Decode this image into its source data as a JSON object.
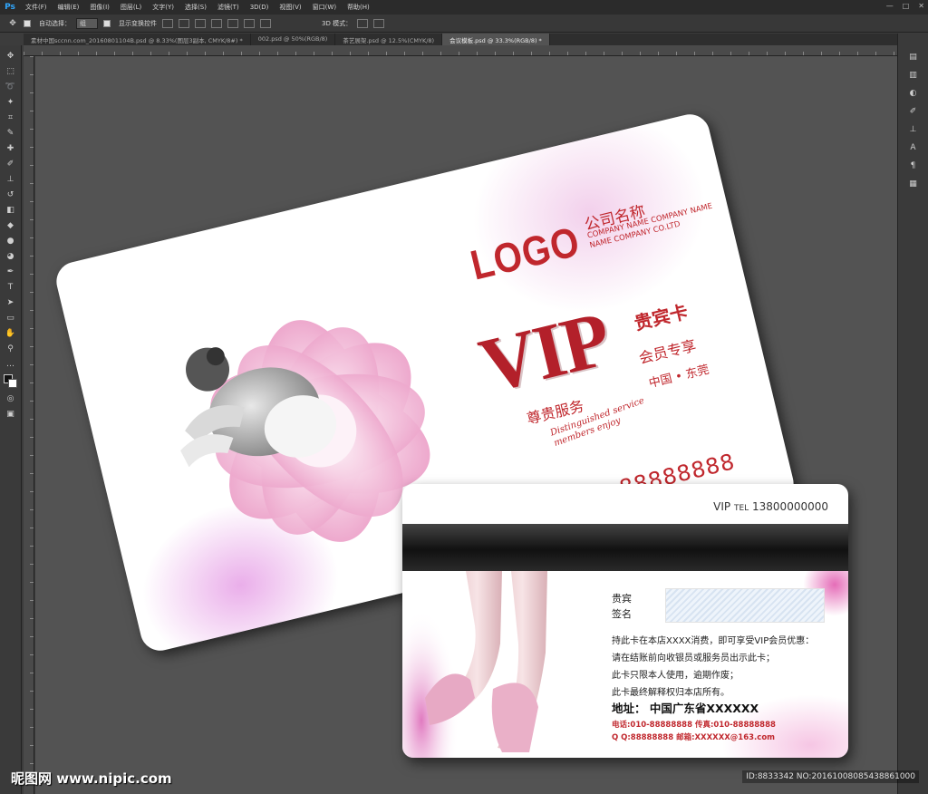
{
  "app": {
    "logo": "Ps"
  },
  "menu": [
    "文件(F)",
    "编辑(E)",
    "图像(I)",
    "图层(L)",
    "文字(Y)",
    "选择(S)",
    "滤镜(T)",
    "3D(D)",
    "视图(V)",
    "窗口(W)",
    "帮助(H)"
  ],
  "window_controls": [
    "—",
    "□",
    "✕"
  ],
  "options": {
    "auto_select_label": "自动选择：",
    "auto_select_value": "组",
    "show_transform_label": "显示变换控件",
    "mode_3d_label": "3D 模式："
  },
  "tabs": [
    "素材中国sccnn.com_20160801104B.psd @ 8.33%(图层3副本, CMYK/8#) *",
    "002.psd @ 50%(RGB/8)",
    "茶艺展架.psd @ 12.5%(CMYK/8)",
    "会议模板.psd @ 33.3%(RGB/8) *"
  ],
  "front_card": {
    "logo": "LOGO",
    "company_cn": "公司名称",
    "company_en_1": "COMPANY NAME COMPANY NAME",
    "company_en_2": "NAME COMPANY CO.LTD",
    "vip": "VIP",
    "vip_sub": "贵宾卡",
    "tag_1": "尊贵服务",
    "tag_2": "会员专享",
    "script_1": "Distinguished service",
    "script_2": "members enjoy",
    "city": "中国 • 东莞",
    "card_no": "No:88888888"
  },
  "back_card": {
    "header_vip": "VIP",
    "header_tel_label": "TEL",
    "header_tel": "13800000000",
    "guest_line_1": "贵宾",
    "guest_line_2": "签名",
    "rules": [
      "持此卡在本店XXXX消费，即可享受VIP会员优惠：",
      "请在结账前向收银员或服务员出示此卡；",
      "此卡只限本人使用，逾期作废；",
      "此卡最终解释权归本店所有。"
    ],
    "address": "地址：  中国广东省XXXXXX",
    "contact_1": "电话:010-88888888  传真:010-88888888",
    "contact_2": "Q Q:88888888  邮箱:XXXXXX@163.com"
  },
  "watermark": {
    "site": "昵图网 www.nipic.com",
    "id": "ID:8833342 NO:20161008085438861000"
  },
  "colors": {
    "brand_red": "#c0272d",
    "petal_pink": "#f2b8d6",
    "canvas_bg": "#535353"
  }
}
